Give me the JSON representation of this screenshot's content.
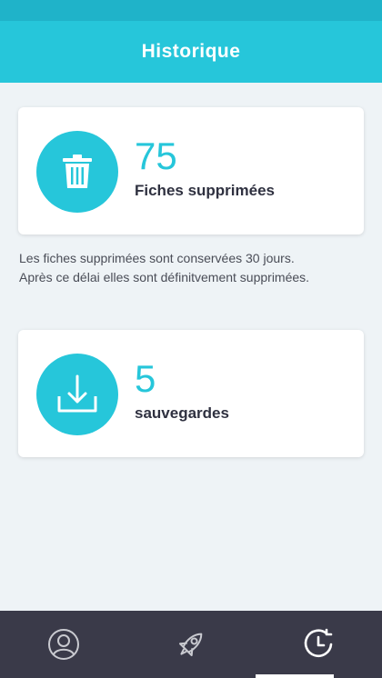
{
  "header": {
    "title": "Historique"
  },
  "deleted_card": {
    "count": "75",
    "label": "Fiches supprimées",
    "icon": "trash-icon"
  },
  "info": {
    "line1": "Les fiches supprimées sont conservées 30 jours.",
    "line2": "Après ce délai elles sont définitvement supprimées."
  },
  "backup_card": {
    "count": "5",
    "label": "sauvegardes",
    "icon": "download-icon"
  },
  "bottom_nav": {
    "items": [
      {
        "icon": "user-icon",
        "active": false
      },
      {
        "icon": "rocket-icon",
        "active": false
      },
      {
        "icon": "history-icon",
        "active": true
      }
    ]
  },
  "colors": {
    "accent": "#26c6da",
    "status_bar": "#1fb3c9",
    "nav_bg": "#3a3a49",
    "background": "#eef3f6"
  }
}
